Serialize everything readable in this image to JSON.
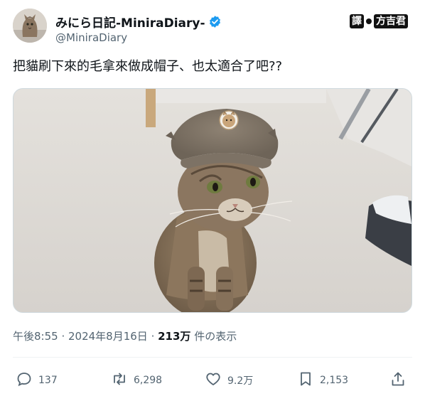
{
  "author": {
    "display_name": "みにら日記-MiniraDiary-",
    "handle": "@MiniraDiary",
    "verified_icon": "verified-badge-icon"
  },
  "watermark": {
    "left": "譯",
    "right": "方吉君"
  },
  "tweet": {
    "text": "把貓刷下來的毛拿來做成帽子、也太適合了吧??"
  },
  "meta": {
    "time": "午後8:55",
    "sep1": " · ",
    "date": "2024年8月16日",
    "sep2": " · ",
    "views_count": "213万",
    "views_label": " 件の表示"
  },
  "actions": {
    "replies": "137",
    "retweets": "6,298",
    "likes": "9.2万",
    "bookmarks": "2,153"
  },
  "colors": {
    "text": "#0f1419",
    "secondary": "#536471",
    "verified": "#1d9bf0"
  }
}
